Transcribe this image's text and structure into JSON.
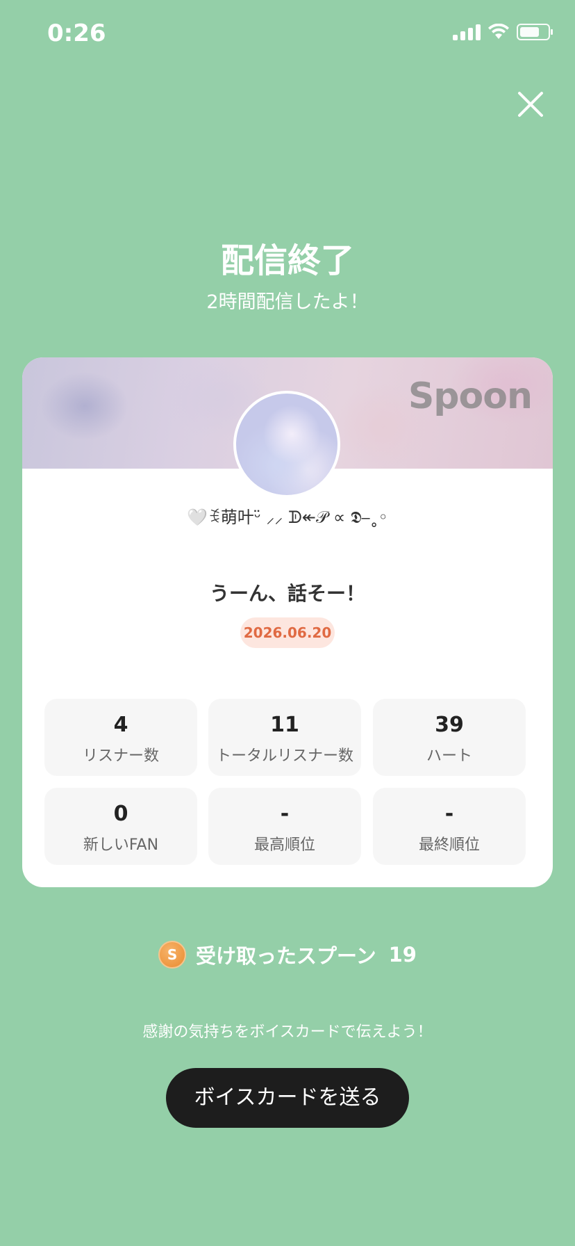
{
  "status_bar": {
    "time": "0:26",
    "battery_level": 0.72
  },
  "header": {
    "title": "配信終了",
    "subtitle": "2時間配信したよ！"
  },
  "card": {
    "banner_logo": "Spoon",
    "username": "🤍ꉂ萌叶ᵕ̈ ⸝⸝ ᗫ↞𝒫 ∝ 𝕯⎯˳◦",
    "broadcast_title": "うーん、話そー！",
    "date": "2026.06.20",
    "stats": [
      {
        "value": "4",
        "label": "リスナー数"
      },
      {
        "value": "11",
        "label": "トータルリスナー数"
      },
      {
        "value": "39",
        "label": "ハート"
      },
      {
        "value": "0",
        "label": "新しいFAN"
      },
      {
        "value": "-",
        "label": "最高順位"
      },
      {
        "value": "-",
        "label": "最終順位"
      }
    ]
  },
  "spoons": {
    "coin_symbol": "S",
    "label": "受け取ったスプーン",
    "count": "19"
  },
  "thanks_text": "感謝の気持ちをボイスカードで伝えよう！",
  "voice_card_button": "ボイスカードを送る",
  "icons": {
    "close": "close-icon",
    "coin": "spoon-coin-icon",
    "signal": "signal-icon",
    "wifi": "wifi-icon",
    "battery": "battery-icon"
  },
  "colors": {
    "background": "#94cfa8",
    "button": "#1d1d1d",
    "date_badge_bg": "#fde6df",
    "date_badge_text": "#e06a43"
  }
}
